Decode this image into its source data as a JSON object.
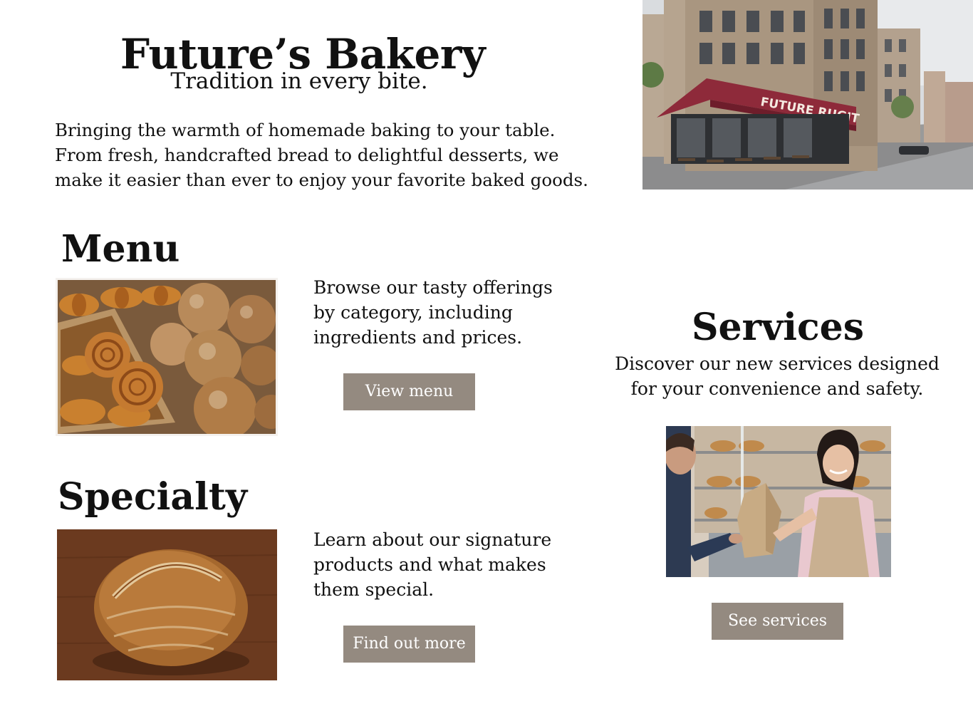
{
  "hero": {
    "title": "Future’s Bakery",
    "tagline": "Tradition in every bite.",
    "intro": "Bringing the warmth of homemade baking to your table. From fresh, handcrafted bread to delightful desserts, we make it easier than ever to enjoy your favorite baked goods.",
    "storefront_sign": "FUTURE RUGIT"
  },
  "menu": {
    "title": "Menu",
    "description": "Browse our tasty offerings by category, including ingredients and prices.",
    "button_label": "View menu"
  },
  "specialty": {
    "title": "Specialty",
    "description": "Learn about our signature products and what makes them special.",
    "button_label": "Find out more"
  },
  "services": {
    "title": "Services",
    "description": "Discover our new services designed for your convenience and safety.",
    "button_label": "See services"
  },
  "colors": {
    "button": "#948a80",
    "text": "#111111",
    "awning": "#8e2a3a"
  }
}
